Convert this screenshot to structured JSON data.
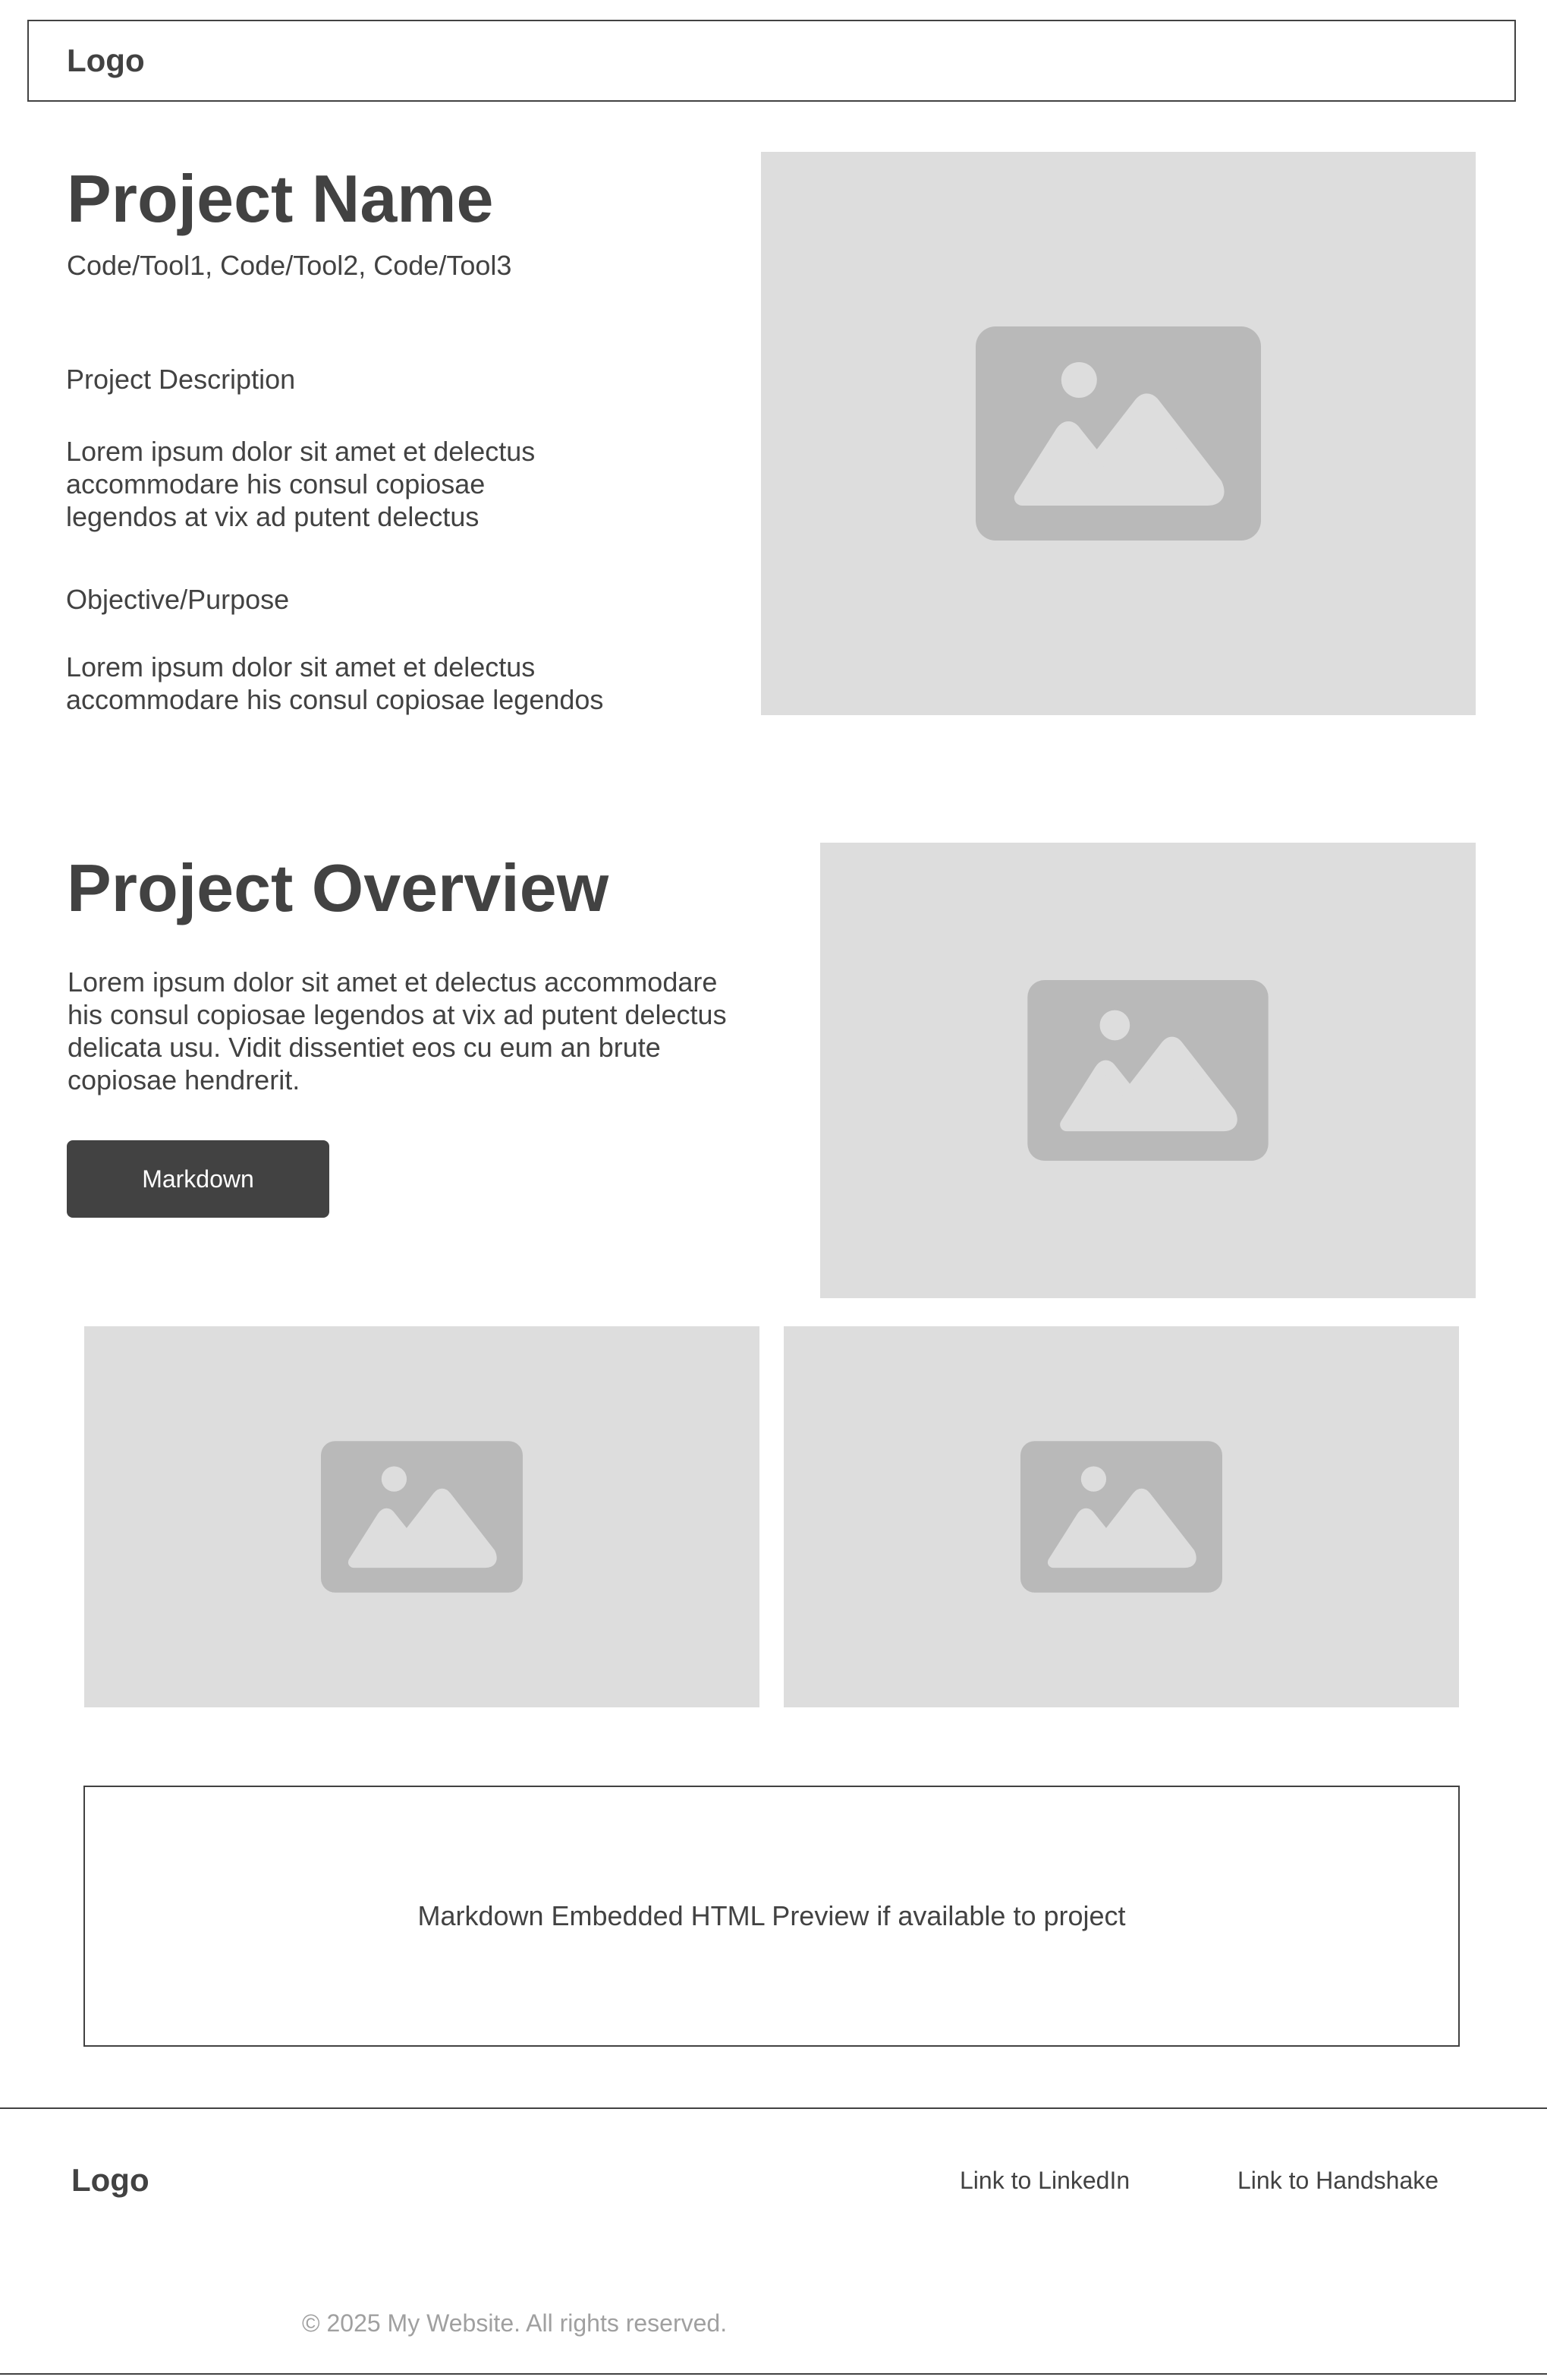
{
  "header": {
    "logo": "Logo"
  },
  "project": {
    "title": "Project Name",
    "tools": "Code/Tool1, Code/Tool2, Code/Tool3",
    "description_label": "Project Description",
    "description_text": "Lorem ipsum dolor sit amet et delectus accommodare his consul copiosae legendos at vix ad putent delectus",
    "objective_label": "Objective/Purpose",
    "objective_text": "Lorem ipsum dolor sit amet et delectus accommodare his consul copiosae legendos"
  },
  "overview": {
    "title": "Project Overview",
    "text": "Lorem ipsum dolor sit amet et delectus accommodare his consul copiosae legendos at vix ad putent delectus delicata usu. Vidit dissentiet eos cu eum an brute copiosae hendrerit.",
    "button_label": "Markdown"
  },
  "preview": {
    "text": "Markdown Embedded HTML Preview if available to project"
  },
  "footer": {
    "logo": "Logo",
    "links": [
      {
        "label": "Link to LinkedIn"
      },
      {
        "label": "Link to Handshake"
      }
    ],
    "copyright": "© 2025 My Website. All rights reserved."
  },
  "icons": {
    "image_placeholder": "image-icon"
  },
  "colors": {
    "text": "#424242",
    "placeholder_bg": "#dddddd",
    "placeholder_icon": "#b9b9b9",
    "button_bg": "#424242",
    "button_text": "#ffffff",
    "muted_text": "#a0a0a0"
  }
}
